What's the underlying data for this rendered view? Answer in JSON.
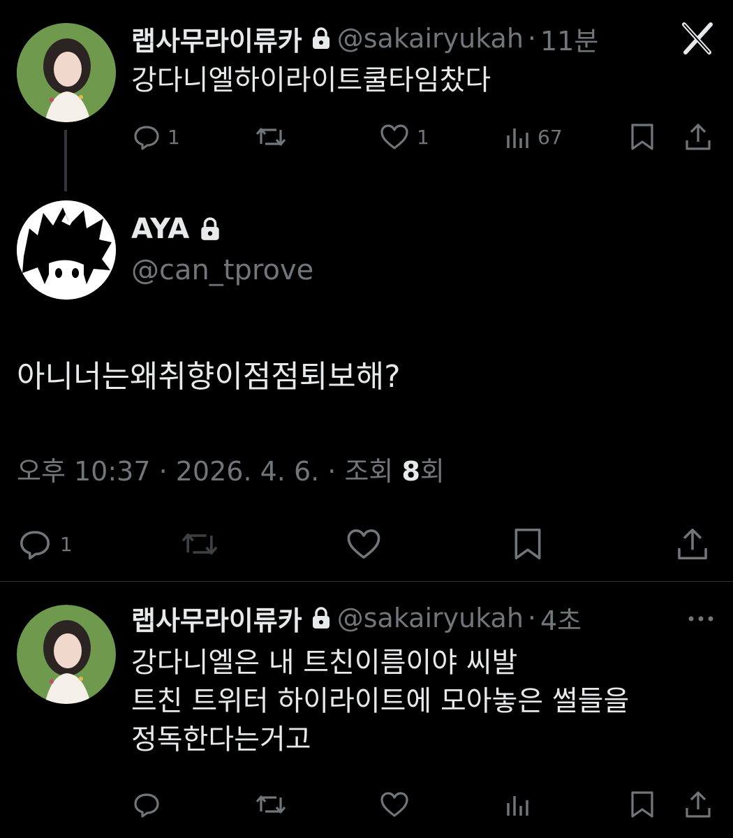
{
  "tweet1": {
    "display_name": "랩사무라이류카",
    "handle": "@sakairyukah",
    "time": "11분",
    "text": "강다니엘하이라이트쿨타임찼다",
    "replies": "1",
    "likes": "1",
    "views": "67",
    "lock_icon": "lock-icon",
    "close_icon": "x-close-icon"
  },
  "main_tweet": {
    "display_name": "AYA",
    "handle": "@can_tprove",
    "text": "아니너는왜취향이점점퇴보해?",
    "meta_time": "오후 10:37 · 2026. 4. 6. · 조회 ",
    "meta_views": "8",
    "meta_views_suffix": "회",
    "replies": "1"
  },
  "reply_tweet": {
    "display_name": "랩사무라이류카",
    "handle": "@sakairyukah",
    "time": "4초",
    "line1": "강다니엘은 내 트친이름이야 씨발",
    "line2": "트친 트위터 하이라이트에 모아놓은 썰들을",
    "line3": "정독한다는거고"
  },
  "colors": {
    "background": "#000000",
    "text": "#e7e9ea",
    "muted": "#71767b",
    "divider": "#2f3336"
  }
}
